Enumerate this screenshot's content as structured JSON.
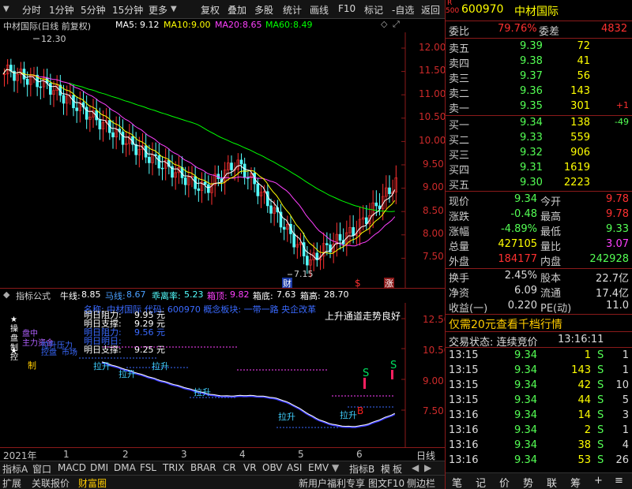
{
  "toolbar": {
    "tabs": [
      "分时",
      "1分钟",
      "5分钟",
      "15分钟",
      "更多"
    ],
    "buttons": [
      "复权",
      "叠加",
      "多股",
      "统计",
      "画线",
      "F10",
      "标记",
      "-自选",
      "返回"
    ]
  },
  "chart_header": {
    "title": "中材国际(日线 前复权)",
    "ma5_label": "MA5:",
    "ma5": "9.12",
    "ma10_label": "MA10:",
    "ma10": "9.00",
    "ma20_label": "MA20:",
    "ma20": "8.65",
    "ma60_label": "MA60:",
    "ma60": "8.49"
  },
  "price_axis": {
    "ticks": [
      "12.00",
      "11.50",
      "11.00",
      "10.50",
      "10.00",
      "9.50",
      "9.00",
      "8.50",
      "8.00",
      "7.50"
    ],
    "high_mark": "12.30",
    "low_mark": "7.15",
    "markers": [
      "财",
      "$",
      "涨"
    ]
  },
  "indicator_header": {
    "name": "指标公式",
    "niu_label": "牛线:",
    "niu": "8.85",
    "ma_label": "马线:",
    "ma": "8.67",
    "gl_label": "乖离率:",
    "gl": "5.23",
    "xd_label": "箱顶:",
    "xd": "9.82",
    "xdi_label": "箱底:",
    "xdi": "7.63",
    "xg_label": "箱高:",
    "xg": "28.70"
  },
  "indicator_panel": {
    "ticks": [
      "12.50",
      "10.50",
      "9.00",
      "7.50"
    ],
    "stock_info": "名称: 中材国际 代码: 600970 概念板块: 一带一路 央企改革",
    "trend_note": "上升通道走势良好",
    "levels": [
      {
        "label": "明日阻力:",
        "value": "9.95 元"
      },
      {
        "label": "明日支撑:",
        "value": "9.29 元"
      },
      {
        "label": "明日阻力:",
        "value": "9.56 元"
      },
      {
        "label": "明日明日:",
        "value": ""
      },
      {
        "label": "明日支撑:",
        "value": "9.25 元"
      }
    ],
    "side_marks": [
      "★",
      "操",
      "盘",
      "控",
      "制",
      "★"
    ],
    "side_words": [
      "盘中",
      "主力资金",
      "控盘",
      "市场"
    ],
    "pull_up_label": "拉升",
    "pull_up_top": "拉升压力",
    "buy_mark": "B",
    "sell_mark": "S"
  },
  "x_axis": {
    "year": "2021年",
    "months": [
      "1",
      "2",
      "3",
      "4",
      "5",
      "6"
    ],
    "period": "日线"
  },
  "bottom_tabs": [
    "指标A",
    "窗口",
    "MACD",
    "DMI",
    "DMA",
    "FSL",
    "TRIX",
    "BRAR",
    "CR",
    "VR",
    "OBV",
    "ASI",
    "EMV"
  ],
  "bottom_tabs_right": [
    "指标B",
    "模",
    "板"
  ],
  "bottom_bar": {
    "left": [
      "扩展",
      "关联报价",
      "财富圈"
    ],
    "right": [
      "新用户福利专享",
      "图文F10",
      "侧边栏"
    ],
    "icons": [
      "笔",
      "记",
      "价",
      "势",
      "联",
      "筹",
      "+"
    ]
  },
  "stock": {
    "r_badge": "R",
    "code_badge": "500",
    "code": "600970",
    "name": "中材国际"
  },
  "order_ratio": {
    "wb_label": "委比",
    "wb": "79.76%",
    "wc_label": "委差",
    "wc": "4832"
  },
  "asks": [
    {
      "label": "卖五",
      "price": "9.39",
      "vol": "72",
      "chg": ""
    },
    {
      "label": "卖四",
      "price": "9.38",
      "vol": "41",
      "chg": ""
    },
    {
      "label": "卖三",
      "price": "9.37",
      "vol": "56",
      "chg": ""
    },
    {
      "label": "卖二",
      "price": "9.36",
      "vol": "143",
      "chg": ""
    },
    {
      "label": "卖一",
      "price": "9.35",
      "vol": "301",
      "chg": "+1"
    }
  ],
  "bids": [
    {
      "label": "买一",
      "price": "9.34",
      "vol": "138",
      "chg": "-49"
    },
    {
      "label": "买二",
      "price": "9.33",
      "vol": "559",
      "chg": ""
    },
    {
      "label": "买三",
      "price": "9.32",
      "vol": "906",
      "chg": ""
    },
    {
      "label": "买四",
      "price": "9.31",
      "vol": "1619",
      "chg": ""
    },
    {
      "label": "买五",
      "price": "9.30",
      "vol": "2223",
      "chg": ""
    }
  ],
  "quote": [
    {
      "l1": "现价",
      "v1": "9.34",
      "l2": "今开",
      "v2": "9.78"
    },
    {
      "l1": "涨跌",
      "v1": "-0.48",
      "l2": "最高",
      "v2": "9.78"
    },
    {
      "l1": "涨幅",
      "v1": "-4.89%",
      "l2": "最低",
      "v2": "9.33"
    },
    {
      "l1": "总量",
      "v1": "427105",
      "l2": "量比",
      "v2": "3.07"
    },
    {
      "l1": "外盘",
      "v1": "184177",
      "l2": "内盘",
      "v2": "242928"
    }
  ],
  "quote2": [
    {
      "l1": "换手",
      "v1": "2.45%",
      "l2": "股本",
      "v2": "22.7亿"
    },
    {
      "l1": "净资",
      "v1": "6.09",
      "l2": "流通",
      "v2": "17.4亿"
    },
    {
      "l1": "收益(一)",
      "v1": "0.220",
      "l2": "PE(动)",
      "v2": "11.0"
    }
  ],
  "promo": {
    "text": "仅需20元查看千档行情",
    "amount": "20"
  },
  "trade_status": {
    "label": "交易状态: 连续竞价",
    "time": "13:16:11"
  },
  "ticks": [
    {
      "t": "13:15",
      "p": "9.34",
      "v": "1",
      "s": "S",
      "n": "1"
    },
    {
      "t": "13:15",
      "p": "9.34",
      "v": "143",
      "s": "S",
      "n": "1"
    },
    {
      "t": "13:15",
      "p": "9.34",
      "v": "42",
      "s": "S",
      "n": "10"
    },
    {
      "t": "13:15",
      "p": "9.34",
      "v": "44",
      "s": "S",
      "n": "5"
    },
    {
      "t": "13:16",
      "p": "9.34",
      "v": "14",
      "s": "S",
      "n": "3"
    },
    {
      "t": "13:16",
      "p": "9.34",
      "v": "2",
      "s": "S",
      "n": "1"
    },
    {
      "t": "13:16",
      "p": "9.34",
      "v": "38",
      "s": "S",
      "n": "4"
    },
    {
      "t": "13:16",
      "p": "9.34",
      "v": "53",
      "s": "S",
      "n": "26"
    }
  ],
  "colors": {
    "ma5": "#ffffff",
    "ma10": "#ffff00",
    "ma20": "#ff40ff",
    "ma60": "#00ff00",
    "up": "#ff3030",
    "down": "#54ffff",
    "axis": "#8b1a1a"
  }
}
